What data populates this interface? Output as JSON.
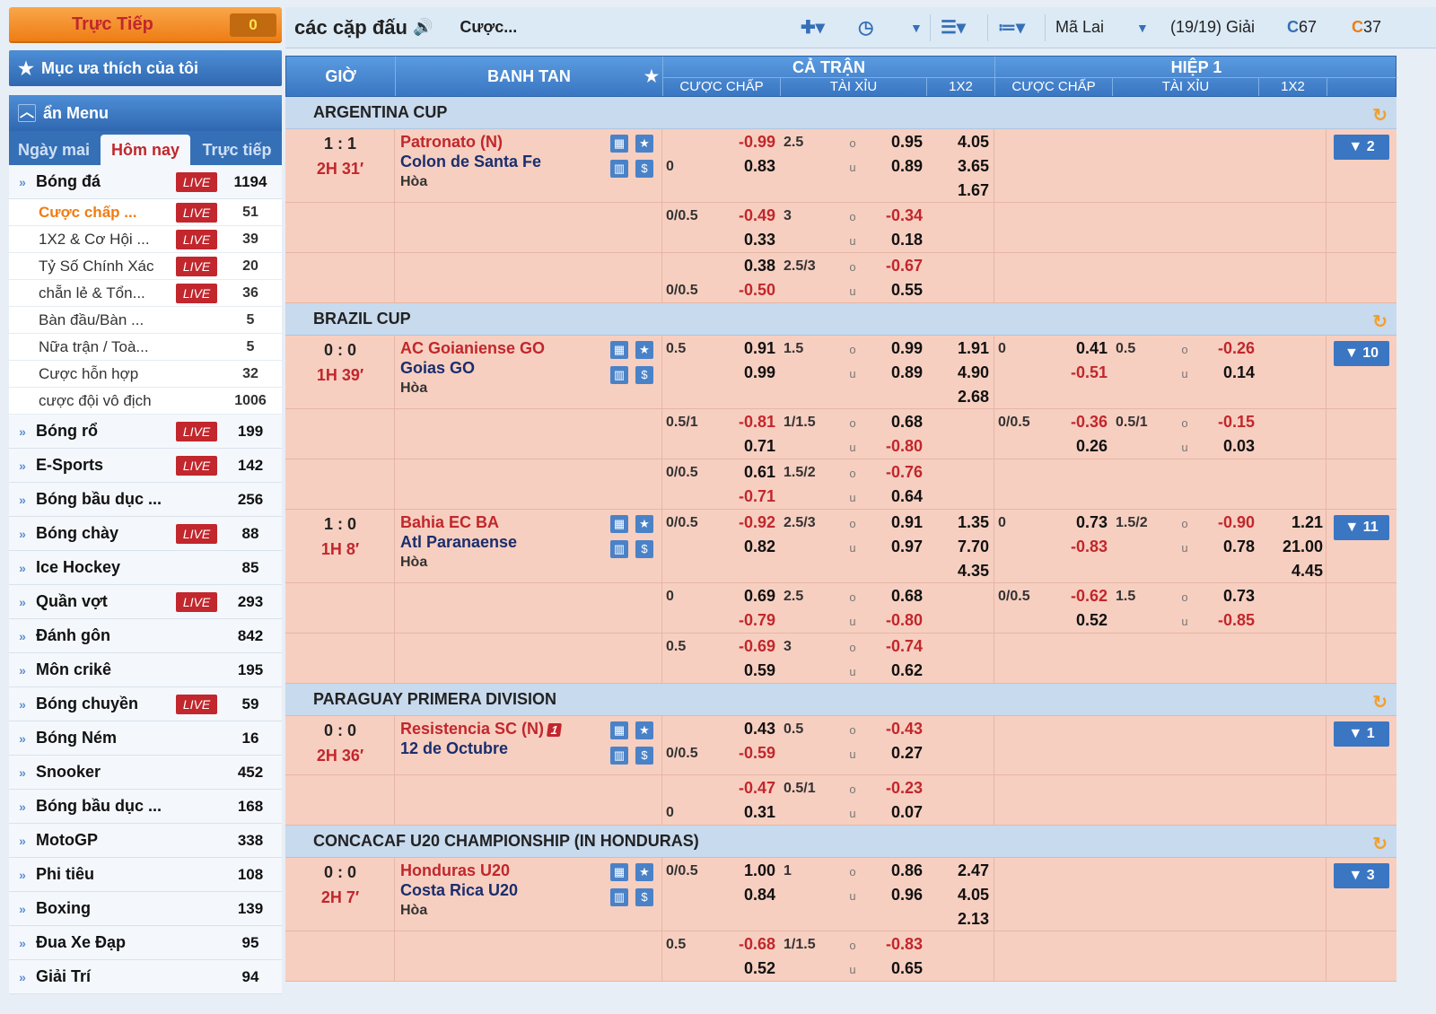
{
  "sidebar": {
    "live_label": "Trực Tiếp",
    "live_count": "0",
    "fav_label": "Mục ưa thích của tôi",
    "menu_label": "ẩn Menu",
    "tabs": [
      "Ngày mai",
      "Hôm nay",
      "Trực tiếp"
    ],
    "soccer": {
      "name": "Bóng đá",
      "live": "LIVE",
      "count": "1194"
    },
    "subs": [
      {
        "name": "Cược chấp ...",
        "live": "LIVE",
        "count": "51"
      },
      {
        "name": "1X2 & Cơ Hội ...",
        "live": "LIVE",
        "count": "39"
      },
      {
        "name": "Tỷ Số Chính Xác",
        "live": "LIVE",
        "count": "20"
      },
      {
        "name": "chẵn lẻ & Tổn...",
        "live": "LIVE",
        "count": "36"
      },
      {
        "name": "Bàn đầu/Bàn ...",
        "live": "",
        "count": "5"
      },
      {
        "name": "Nữa trận / Toà...",
        "live": "",
        "count": "5"
      },
      {
        "name": "Cược hỗn hợp",
        "live": "",
        "count": "32"
      },
      {
        "name": "cược đội vô địch",
        "live": "",
        "count": "1006"
      }
    ],
    "sports": [
      {
        "name": "Bóng rổ",
        "live": "LIVE",
        "count": "199"
      },
      {
        "name": "E-Sports",
        "live": "LIVE",
        "count": "142"
      },
      {
        "name": "Bóng bầu dục ...",
        "live": "",
        "count": "256"
      },
      {
        "name": "Bóng chày",
        "live": "LIVE",
        "count": "88"
      },
      {
        "name": "Ice Hockey",
        "live": "",
        "count": "85"
      },
      {
        "name": "Quần vợt",
        "live": "LIVE",
        "count": "293"
      },
      {
        "name": "Đánh gôn",
        "live": "",
        "count": "842"
      },
      {
        "name": "Môn crikê",
        "live": "",
        "count": "195"
      },
      {
        "name": "Bóng chuyền",
        "live": "LIVE",
        "count": "59"
      },
      {
        "name": "Bóng Ném",
        "live": "",
        "count": "16"
      },
      {
        "name": "Snooker",
        "live": "",
        "count": "452"
      },
      {
        "name": "Bóng bầu dục ...",
        "live": "",
        "count": "168"
      },
      {
        "name": "MotoGP",
        "live": "",
        "count": "338"
      },
      {
        "name": "Phi tiêu",
        "live": "",
        "count": "108"
      },
      {
        "name": "Boxing",
        "live": "",
        "count": "139"
      },
      {
        "name": "Đua Xe Đạp",
        "live": "",
        "count": "95"
      },
      {
        "name": "Giải Trí",
        "live": "",
        "count": "94"
      }
    ]
  },
  "topbar": {
    "title": "các cặp đấu",
    "bet": "Cược...",
    "odds_type": "Mã Lai",
    "leagues": "(19/19) Giải",
    "count1": "67",
    "count2": "37"
  },
  "header": {
    "time": "GIỜ",
    "teams": "BANH TAN",
    "full": "CẢ TRẬN",
    "half": "HIỆP 1",
    "hdp": "CƯỢC CHẤP",
    "ou": "TÀI XỈU",
    "x12": "1X2"
  },
  "labels": {
    "draw": "Hòa",
    "over": "o",
    "under": "u"
  }
}
